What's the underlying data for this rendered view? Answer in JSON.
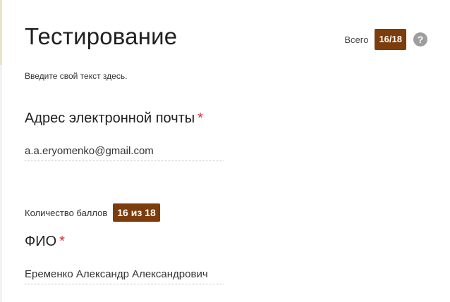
{
  "form": {
    "title": "Тестирование",
    "description": "Введите свой текст здесь.",
    "total_label": "Всего",
    "total_score": "16/18",
    "help_icon_symbol": "?"
  },
  "questions": [
    {
      "title": "Адрес электронной почты",
      "required_mark": "*",
      "answer": "a.a.eryomenko@gmail.com"
    },
    {
      "points_label": "Количество баллов",
      "points_value": "16 из 18",
      "title": "ФИО",
      "required_mark": "*",
      "answer": "Еременко Александр Александрович"
    }
  ],
  "colors": {
    "badge": "#7d3c0b",
    "required": "#d32f2f"
  }
}
